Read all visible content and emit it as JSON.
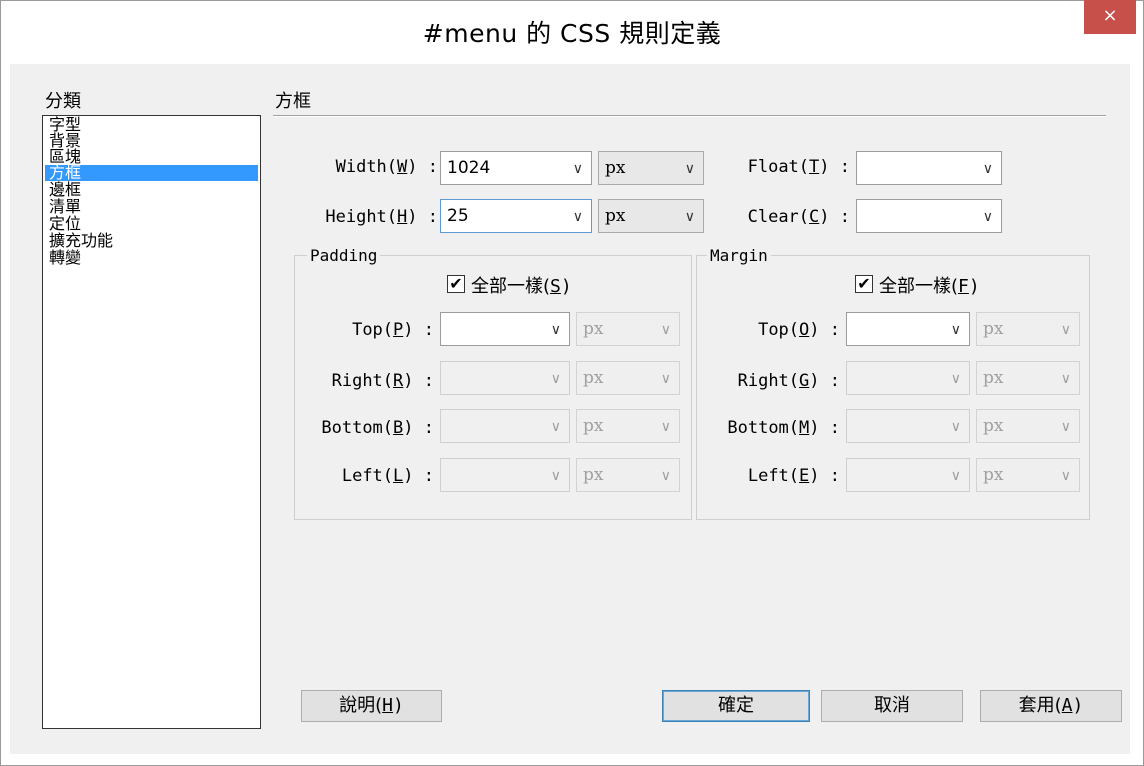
{
  "window": {
    "title": "#menu 的 CSS 規則定義",
    "close_glyph": "×"
  },
  "category": {
    "heading": "分類",
    "items": [
      "字型",
      "背景",
      "區塊",
      "方框",
      "邊框",
      "清單",
      "定位",
      "擴充功能",
      "轉變"
    ],
    "selected": "方框"
  },
  "box": {
    "section_title": "方框",
    "width": {
      "label_pre": "Width(",
      "key": "W",
      "label_post": ") :",
      "value": "1024",
      "unit": "px"
    },
    "height": {
      "label_pre": "Height(",
      "key": "H",
      "label_post": ") :",
      "value": "25",
      "unit": "px"
    },
    "float": {
      "label_pre": "Float(",
      "key": "T",
      "label_post": ") :",
      "value": ""
    },
    "clear": {
      "label_pre": "Clear(",
      "key": "C",
      "label_post": ") :",
      "value": ""
    }
  },
  "padding": {
    "legend": "Padding",
    "same_label_pre": "全部一樣(",
    "same_key": "S",
    "same_label_post": ")",
    "same_checked": true,
    "rows": [
      {
        "pre": "Top(",
        "key": "P",
        "post": ") :",
        "value": "",
        "unit": "px"
      },
      {
        "pre": "Right(",
        "key": "R",
        "post": ") :",
        "value": "",
        "unit": "px"
      },
      {
        "pre": "Bottom(",
        "key": "B",
        "post": ") :",
        "value": "",
        "unit": "px"
      },
      {
        "pre": "Left(",
        "key": "L",
        "post": ") :",
        "value": "",
        "unit": "px"
      }
    ]
  },
  "margin": {
    "legend": "Margin",
    "same_label_pre": "全部一樣(",
    "same_key": "F",
    "same_label_post": ")",
    "same_checked": true,
    "rows": [
      {
        "pre": "Top(",
        "key": "O",
        "post": ") :",
        "value": "",
        "unit": "px"
      },
      {
        "pre": "Right(",
        "key": "G",
        "post": ") :",
        "value": "",
        "unit": "px"
      },
      {
        "pre": "Bottom(",
        "key": "M",
        "post": ") :",
        "value": "",
        "unit": "px"
      },
      {
        "pre": "Left(",
        "key": "E",
        "post": ") :",
        "value": "",
        "unit": "px"
      }
    ]
  },
  "buttons": {
    "help_pre": "說明(",
    "help_key": "H",
    "help_post": ")",
    "ok": "確定",
    "cancel": "取消",
    "apply_pre": "套用(",
    "apply_key": "A",
    "apply_post": ")"
  },
  "glyphs": {
    "arrow": "∨",
    "check": "✔"
  },
  "colors": {
    "selection": "#3399ff",
    "close_button": "#c7504a",
    "focus_border": "#5b9bd5"
  }
}
